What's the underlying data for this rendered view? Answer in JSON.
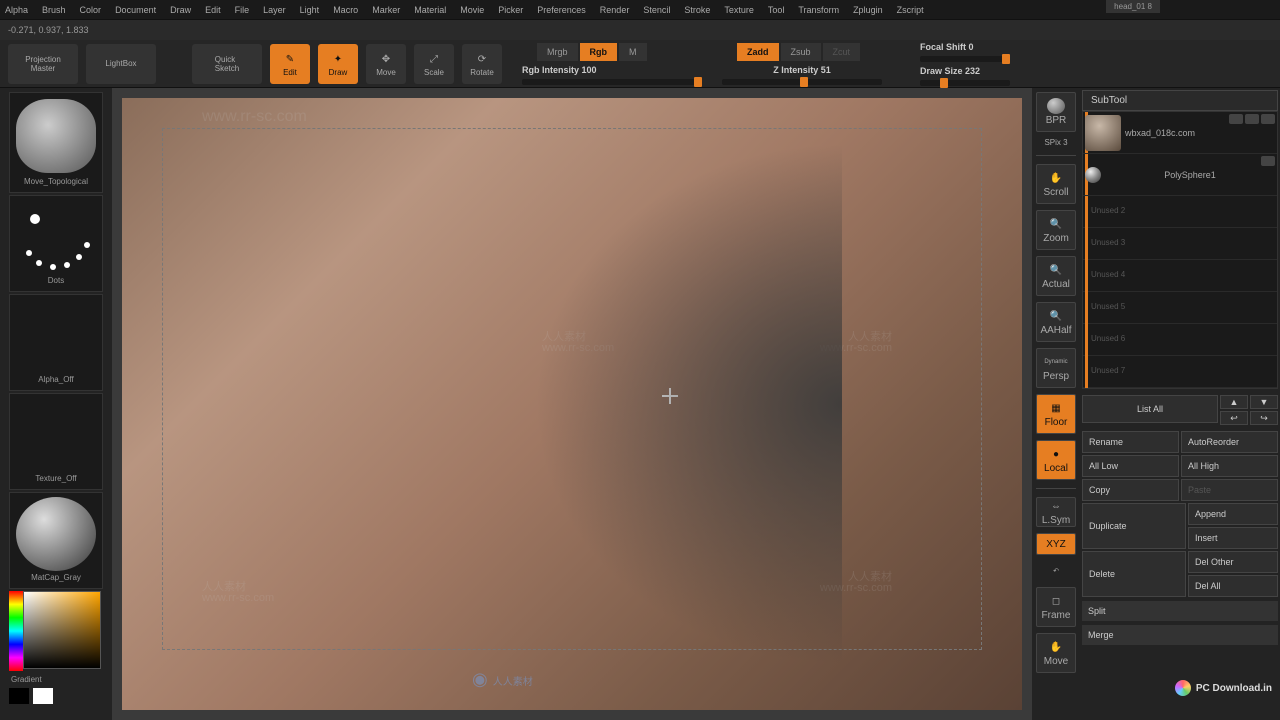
{
  "menu": [
    "Alpha",
    "Brush",
    "Color",
    "Document",
    "Draw",
    "Edit",
    "File",
    "Layer",
    "Light",
    "Macro",
    "Marker",
    "Material",
    "Movie",
    "Picker",
    "Preferences",
    "Render",
    "Stencil",
    "Stroke",
    "Texture",
    "Tool",
    "Transform",
    "Zplugin",
    "Zscript"
  ],
  "coords": "-0.271, 0.937, 1.833",
  "file_tab": "head_01 8",
  "toolbar": {
    "projection": "Projection\nMaster",
    "lightbox": "LightBox",
    "quicksketch": "Quick\nSketch",
    "edit": "Edit",
    "draw": "Draw",
    "move": "Move",
    "scale": "Scale",
    "rotate": "Rotate",
    "mrgb": "Mrgb",
    "rgb": "Rgb",
    "m": "M",
    "rgb_intensity": "Rgb Intensity 100",
    "zadd": "Zadd",
    "zsub": "Zsub",
    "zcut": "Zcut",
    "z_intensity": "Z Intensity 51",
    "focal": "Focal Shift 0",
    "draw_size": "Draw Size 232"
  },
  "left": {
    "brush": "Move_Topological",
    "stroke": "Dots",
    "alpha": "Alpha_Off",
    "texture": "Texture_Off",
    "material": "MatCap_Gray",
    "gradient": "Gradient"
  },
  "right_tools": {
    "bpr": "BPR",
    "spix": "SPix 3",
    "scroll": "Scroll",
    "zoom": "Zoom",
    "actual": "Actual",
    "aahalf": "AAHalf",
    "persp": "Persp",
    "persp_top": "Dynamic",
    "floor": "Floor",
    "local": "Local",
    "lsym": "L.Sym",
    "xyz": "XYZ",
    "frame": "Frame",
    "move": "Move"
  },
  "subtool": {
    "header": "SubTool",
    "items": [
      "wbxad_018c.com",
      "PolySphere1"
    ],
    "empty": [
      "Unused 2",
      "Unused 3",
      "Unused 4",
      "Unused 5",
      "Unused 6",
      "Unused 7"
    ],
    "list_all": "List All",
    "buttons": {
      "rename": "Rename",
      "autoreorder": "AutoReorder",
      "all_low": "All Low",
      "all_high": "All High",
      "copy": "Copy",
      "paste": "Paste",
      "duplicate": "Duplicate",
      "append": "Append",
      "insert": "Insert",
      "delete": "Delete",
      "del_other": "Del Other",
      "del_all": "Del All",
      "split": "Split",
      "merge": "Merge"
    }
  },
  "watermark": "www.rr-sc.com",
  "wm2": "人人素材",
  "pcdownload": "PC Download.in"
}
